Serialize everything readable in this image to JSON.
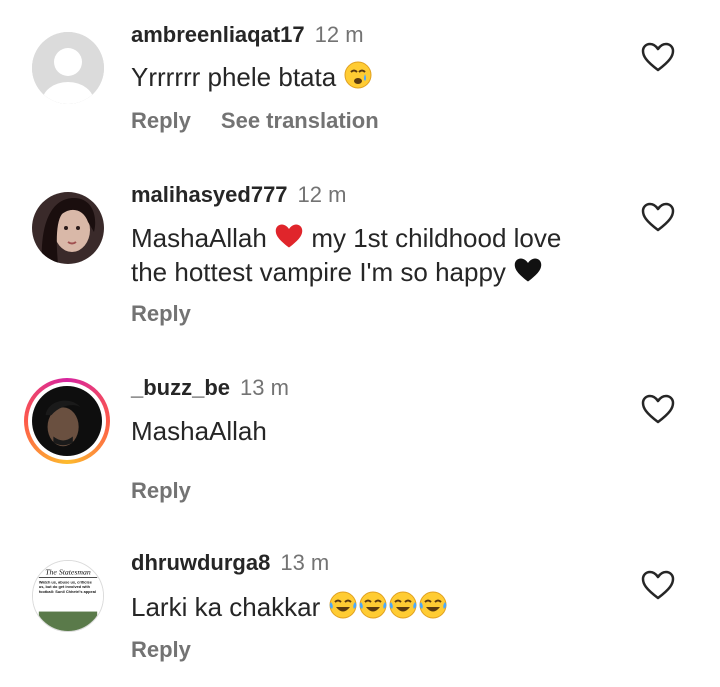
{
  "comments": [
    {
      "username": "ambreenliaqat17",
      "time": "12 m",
      "text": "Yrrrrrr phele btata",
      "emojis": [
        "crying-face"
      ],
      "actions": [
        "Reply",
        "See translation"
      ]
    },
    {
      "username": "malihasyed777",
      "time": "12 m",
      "text_line1": "MashaAllah",
      "text_line1b": "my 1st childhood love",
      "text_line2": "the hottest vampire I'm so happy",
      "emojis": [
        "red-heart",
        "black-heart"
      ],
      "actions": [
        "Reply"
      ]
    },
    {
      "username": "_buzz_be",
      "time": "13 m",
      "text": "MashaAllah",
      "actions": [
        "Reply"
      ]
    },
    {
      "username": "dhruwdurga8",
      "time": "13 m",
      "text": "Larki ka chakkar",
      "emojis": [
        "tears-of-joy",
        "tears-of-joy",
        "tears-of-joy",
        "tears-of-joy"
      ],
      "actions": [
        "Reply"
      ],
      "avatar_text": {
        "masthead": "The Statesman",
        "headline": "Watch us, abuse us, criticise us, but do get involved with football: Sunil Chhetri's appeal"
      }
    }
  ]
}
